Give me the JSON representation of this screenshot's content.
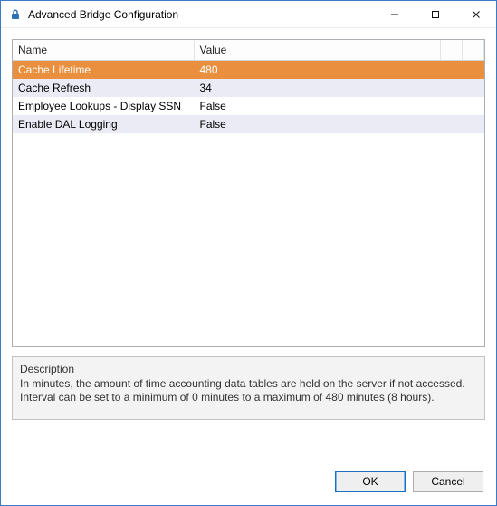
{
  "window": {
    "title": "Advanced Bridge Configuration"
  },
  "grid": {
    "headers": {
      "name": "Name",
      "value": "Value"
    },
    "rows": [
      {
        "name": "Cache Lifetime",
        "value": "480",
        "state": "selected"
      },
      {
        "name": "Cache Refresh",
        "value": "34",
        "state": "alt"
      },
      {
        "name": "Employee Lookups - Display SSN",
        "value": "False",
        "state": "normal"
      },
      {
        "name": "Enable DAL Logging",
        "value": "False",
        "state": "alt"
      }
    ]
  },
  "description": {
    "label": "Description",
    "text": "In minutes, the amount of time accounting data tables are held on the server if not accessed. Interval can be set to a minimum of 0 minutes to a maximum of 480 minutes (8 hours)."
  },
  "buttons": {
    "ok": "OK",
    "cancel": "Cancel"
  }
}
